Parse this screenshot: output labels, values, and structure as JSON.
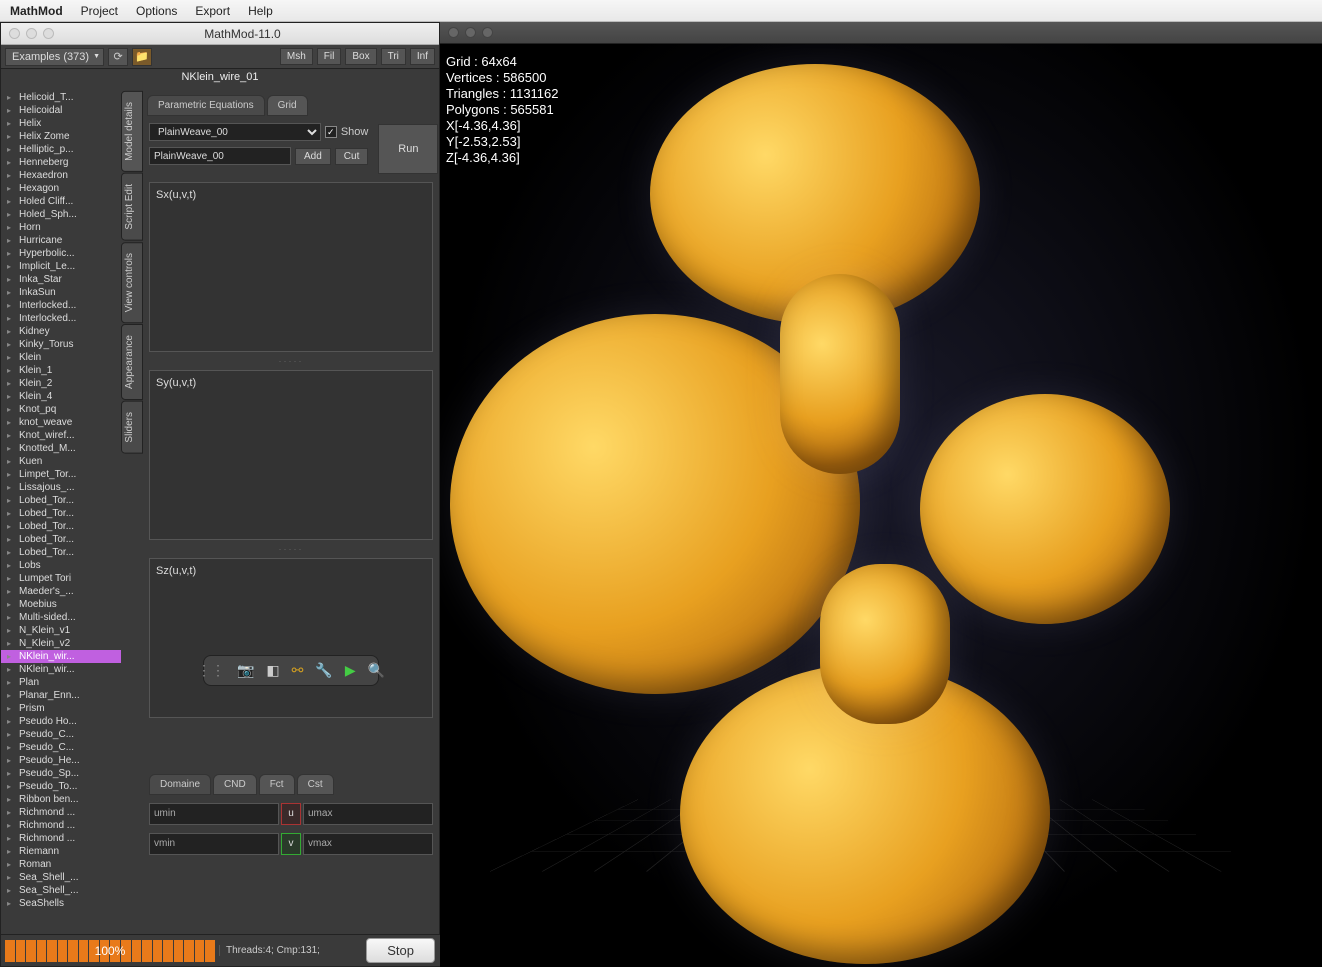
{
  "menubar": {
    "app": "MathMod",
    "items": [
      "Project",
      "Options",
      "Export",
      "Help"
    ]
  },
  "window": {
    "title": "MathMod-11.0"
  },
  "examplesDropdown": "Examples (373)",
  "toolbarButtons": {
    "msh": "Msh",
    "fil": "Fil",
    "box": "Box",
    "tri": "Tri",
    "inf": "Inf"
  },
  "modelTitle": "NKlein_wire_01",
  "examples": [
    "Helicoid_T...",
    "Helicoidal",
    "Helix",
    "Helix Zome",
    "Helliptic_p...",
    "Henneberg",
    "Hexaedron",
    "Hexagon",
    "Holed Cliff...",
    "Holed_Sph...",
    "Horn",
    "Hurricane",
    "Hyperbolic...",
    "Implicit_Le...",
    "Inka_Star",
    "InkaSun",
    "Interlocked...",
    "Interlocked...",
    "Kidney",
    "Kinky_Torus",
    "Klein",
    "Klein_1",
    "Klein_2",
    "Klein_4",
    "Knot_pq",
    "knot_weave",
    "Knot_wiref...",
    "Knotted_M...",
    "Kuen",
    "Limpet_Tor...",
    "Lissajous_...",
    "Lobed_Tor...",
    "Lobed_Tor...",
    "Lobed_Tor...",
    "Lobed_Tor...",
    "Lobed_Tor...",
    "Lobs",
    "Lumpet Tori",
    "Maeder's_...",
    "Moebius",
    "Multi-sided...",
    "N_Klein_v1",
    "N_Klein_v2",
    "NKlein_wir...",
    "NKlein_wir...",
    "Plan",
    "Planar_Enn...",
    "Prism",
    "Pseudo Ho...",
    "Pseudo_C...",
    "Pseudo_C...",
    "Pseudo_He...",
    "Pseudo_Sp...",
    "Pseudo_To...",
    "Ribbon ben...",
    "Richmond ...",
    "Richmond ...",
    "Richmond ...",
    "Riemann",
    "Roman",
    "Sea_Shell_...",
    "Sea_Shell_...",
    "SeaShells"
  ],
  "selectedExample": 43,
  "sideTabs": [
    "Model details",
    "Script Edit",
    "View controls",
    "Appearance",
    "Sliders"
  ],
  "paramTabs": {
    "pe": "Parametric Equations",
    "grid": "Grid"
  },
  "comboValue": "PlainWeave_00",
  "showLabel": "Show",
  "showChecked": true,
  "fieldValue": "PlainWeave_00",
  "addBtn": "Add",
  "cutBtn": "Cut",
  "runBtn": "Run",
  "eq": {
    "sx": "Sx(u,v,t)",
    "sy": "Sy(u,v,t)",
    "sz": "Sz(u,v,t)"
  },
  "bottomTabs": {
    "domaine": "Domaine",
    "cnd": "CND",
    "fct": "Fct",
    "cst": "Cst"
  },
  "domain": {
    "umin": "umin",
    "u": "u",
    "umax": "umax",
    "vmin": "vmin",
    "v": "v",
    "vmax": "vmax"
  },
  "progress": "100%",
  "threads": "Threads:4; Cmp:131;",
  "stop": "Stop",
  "overlay": {
    "grid": "Grid    : 64x64",
    "vertices": "Vertices : 586500",
    "triangles": "Triangles : 1131162",
    "polygons": "Polygons : 565581",
    "x": "X[-4.36,4.36]",
    "y": "Y[-2.53,2.53]",
    "z": "Z[-4.36,4.36]"
  }
}
